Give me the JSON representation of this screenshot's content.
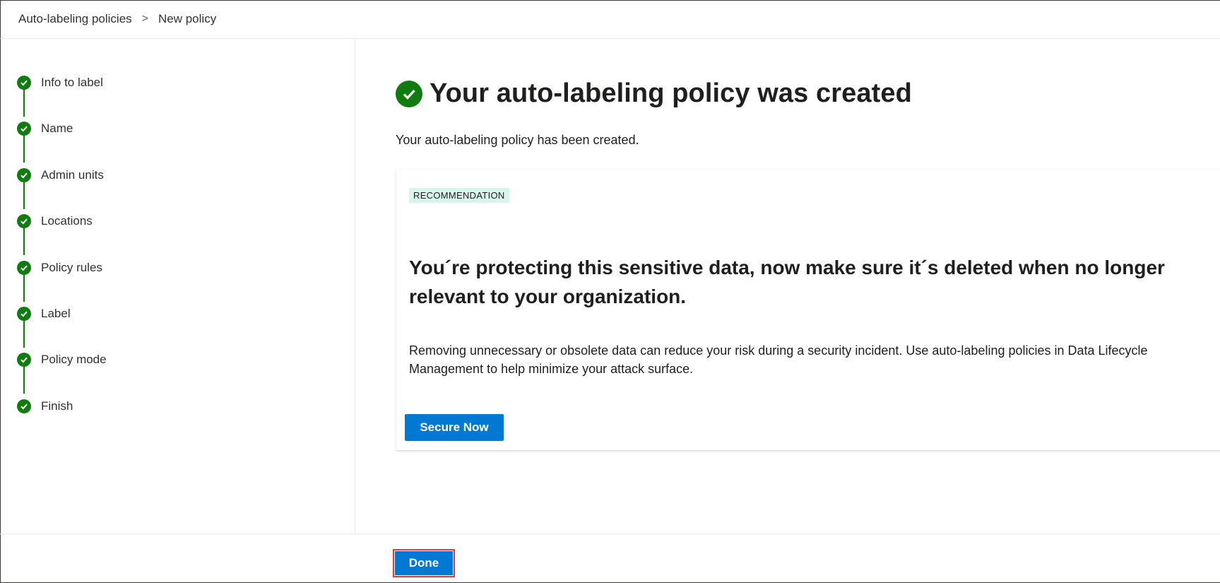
{
  "breadcrumb": {
    "items": [
      "Auto-labeling policies",
      "New policy"
    ],
    "separator": ">"
  },
  "steps": [
    {
      "label": "Info to label",
      "status": "complete"
    },
    {
      "label": "Name",
      "status": "complete"
    },
    {
      "label": "Admin units",
      "status": "complete"
    },
    {
      "label": "Locations",
      "status": "complete"
    },
    {
      "label": "Policy rules",
      "status": "complete"
    },
    {
      "label": "Label",
      "status": "complete"
    },
    {
      "label": "Policy mode",
      "status": "complete"
    },
    {
      "label": "Finish",
      "status": "complete"
    }
  ],
  "main": {
    "title": "Your auto-labeling policy was created",
    "subtitle": "Your auto-labeling policy has been created.",
    "card": {
      "badge": "RECOMMENDATION",
      "heading": "You´re protecting this sensitive data, now make sure it´s deleted when no longer relevant to your organization.",
      "body": "Removing unnecessary or obsolete data can reduce your risk during a security incident. Use auto-labeling policies in Data Lifecycle Management to help minimize your attack surface.",
      "button_label": "Secure Now"
    }
  },
  "footer": {
    "done_label": "Done"
  },
  "colors": {
    "success": "#107c10",
    "primary": "#0078d4",
    "badge_bg": "#d7f5ec",
    "focus_outline": "#e03c31"
  },
  "icons": {
    "step": "checkmark-circle-icon",
    "title": "checkmark-circle-icon",
    "breadcrumb_separator": "chevron-right-icon"
  }
}
